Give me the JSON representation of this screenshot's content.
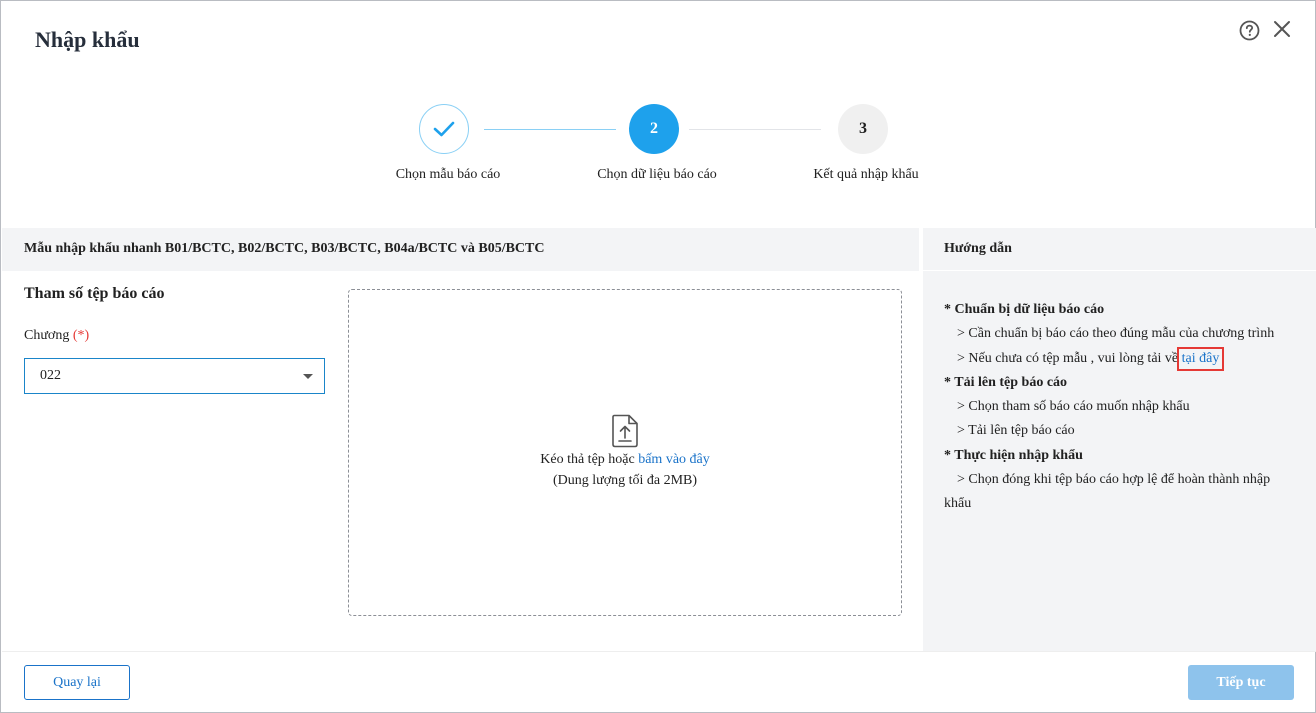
{
  "dialog": {
    "title": "Nhập khẩu"
  },
  "stepper": {
    "steps": [
      {
        "number": "1",
        "label": "Chọn mẫu báo cáo",
        "status": "done"
      },
      {
        "number": "2",
        "label": "Chọn dữ liệu báo cáo",
        "status": "active"
      },
      {
        "number": "3",
        "label": "Kết quả nhập khẩu",
        "status": "pending"
      }
    ]
  },
  "main": {
    "section_header": "Mẫu nhập khẩu nhanh B01/BCTC, B02/BCTC, B03/BCTC, B04a/BCTC và B05/BCTC",
    "param_title": "Tham số tệp báo cáo",
    "chapter_label": "Chương",
    "required_mark": "(*)",
    "chapter_value": "022",
    "dropzone": {
      "text": "Kéo thả tệp hoặc",
      "link": "bấm vào đây",
      "subtext": "(Dung lượng tối đa 2MB)"
    }
  },
  "guide": {
    "header": "Hướng dẫn",
    "sections": [
      {
        "title": "* Chuẩn bị dữ liệu báo cáo",
        "items": [
          "> Cần chuẩn bị báo cáo theo đúng mẫu của chương trình",
          "> Nếu chưa có tệp mẫu , vui lòng tải về"
        ],
        "link": "tại đây"
      },
      {
        "title": "* Tải lên tệp báo cáo",
        "items": [
          "> Chọn tham số báo cáo muốn nhập khẩu",
          "> Tải lên tệp báo cáo"
        ]
      },
      {
        "title": "* Thực hiện nhập khẩu",
        "items": [
          "> Chọn đóng khi tệp báo cáo hợp lệ để hoàn thành nhập khẩu"
        ]
      }
    ]
  },
  "footer": {
    "back_label": "Quay lại",
    "next_label": "Tiếp tục"
  },
  "colors": {
    "accent": "#1ea1ec",
    "link": "#1a73c9",
    "required": "#e53935",
    "disabled_button": "#8ec3ec"
  }
}
